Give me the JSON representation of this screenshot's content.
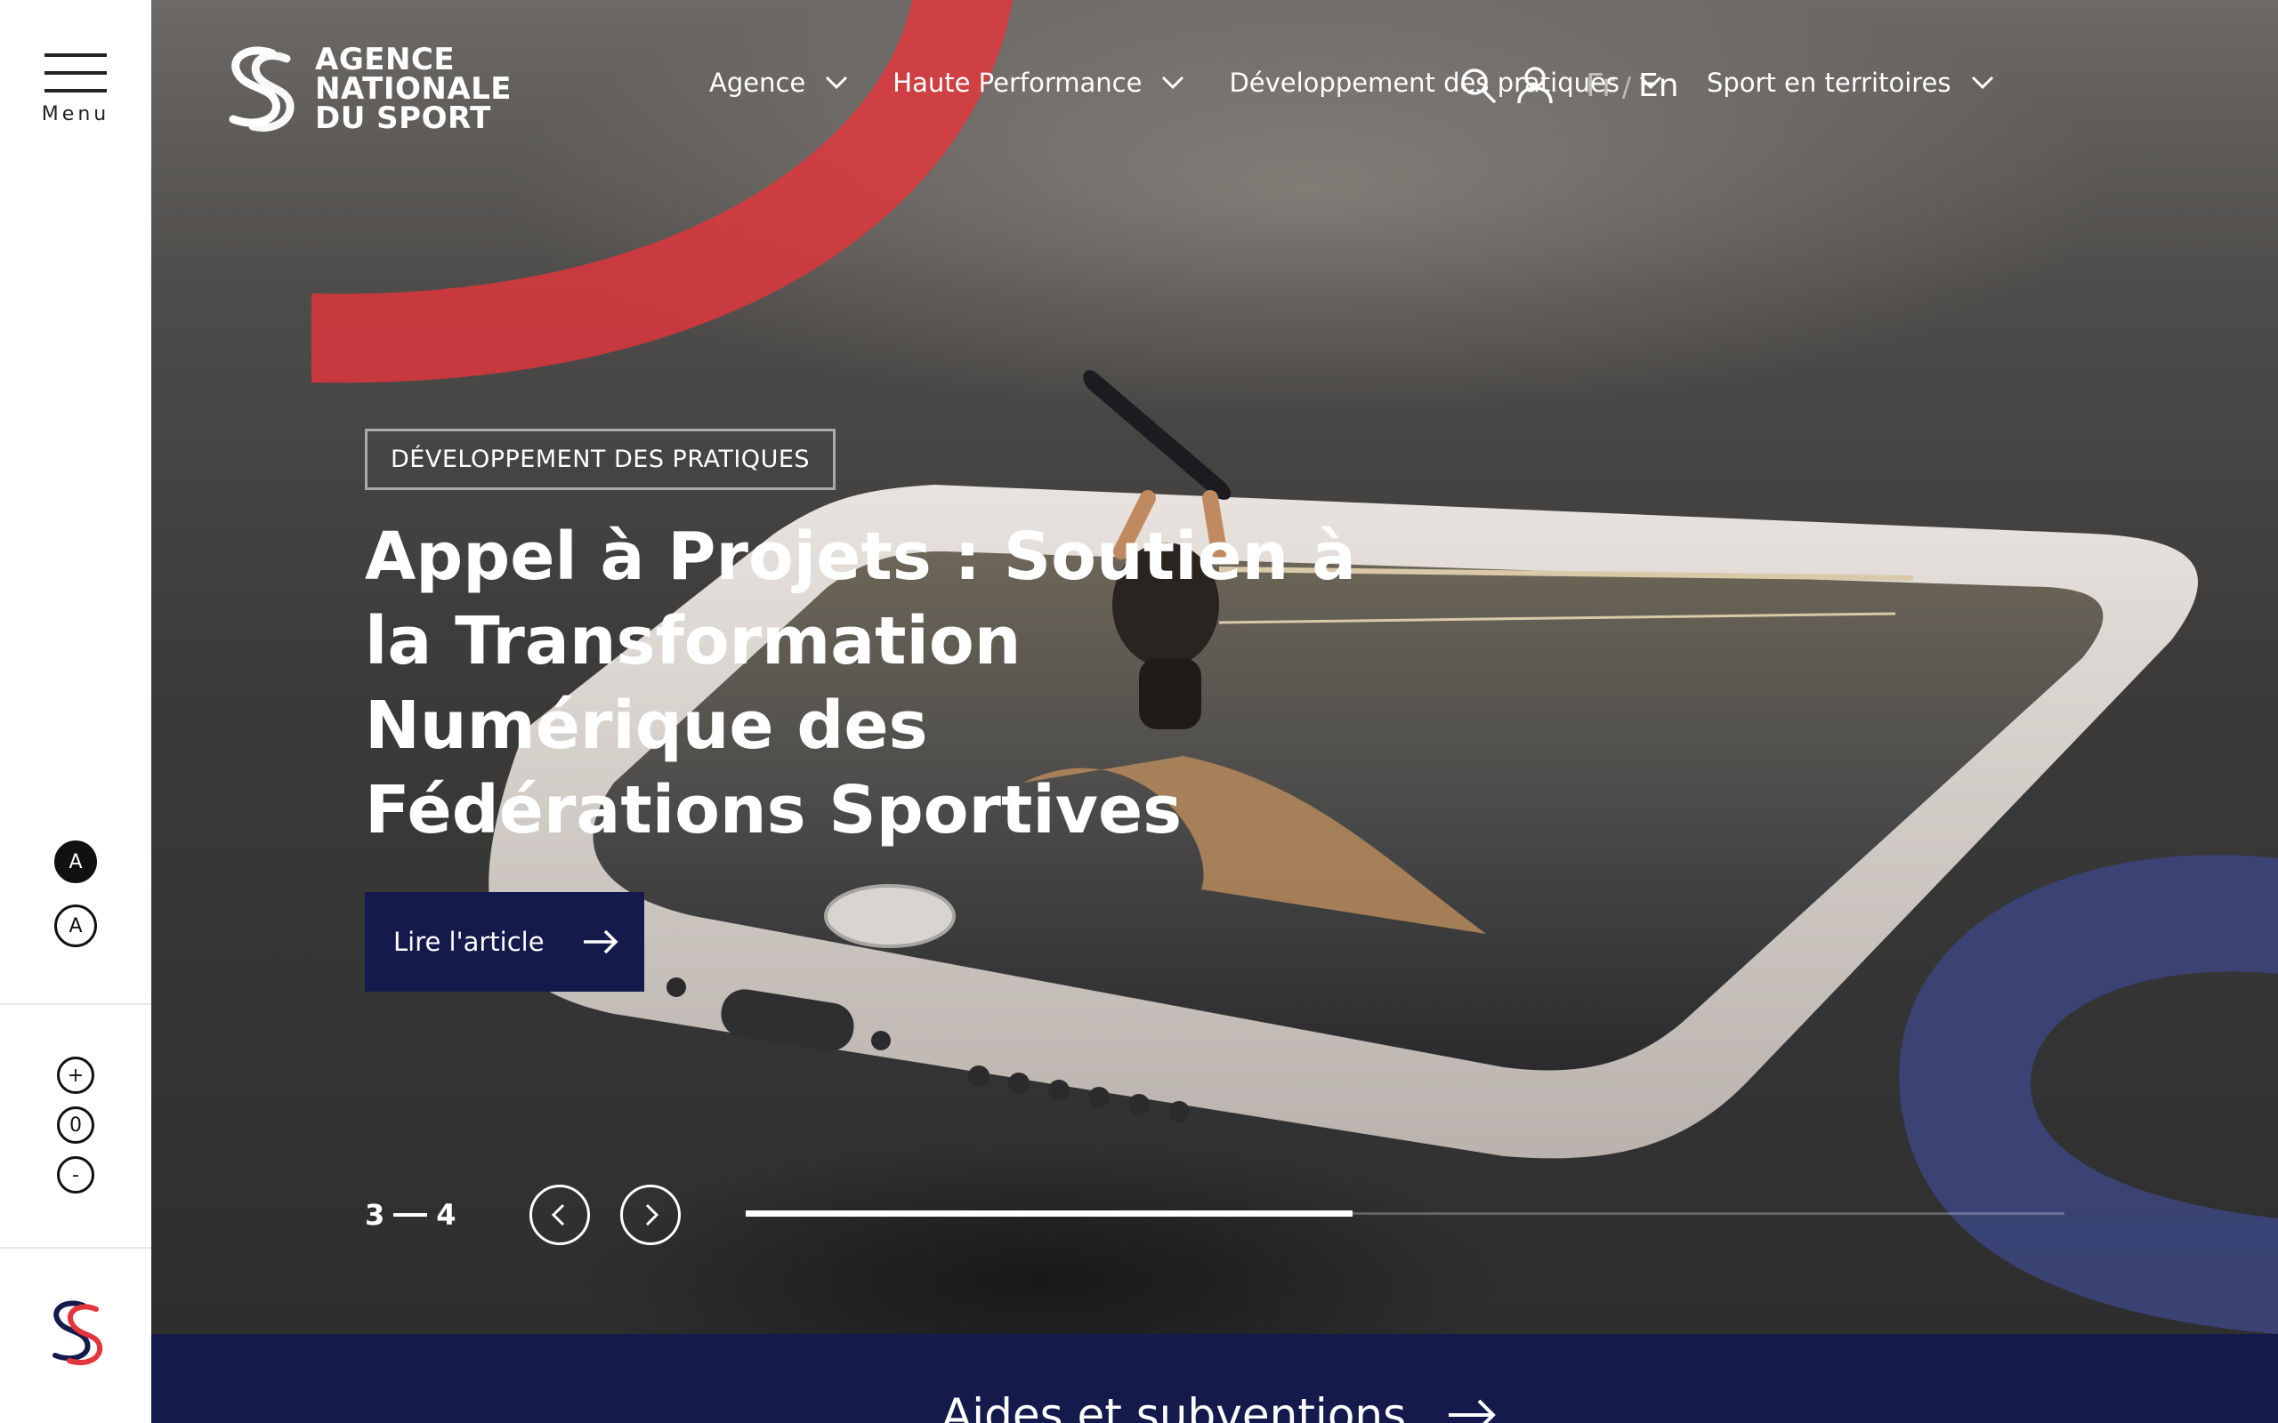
{
  "rail": {
    "menu_label": "Menu",
    "contrast_dark_label": "A",
    "contrast_light_label": "A",
    "zoom_in_label": "+",
    "zoom_reset_label": "0",
    "zoom_out_label": "-"
  },
  "header": {
    "logo_lines": [
      "AGENCE",
      "NATIONALE",
      "DU SPORT"
    ],
    "nav": [
      {
        "label": "Agence"
      },
      {
        "label": "Haute Performance"
      },
      {
        "label": "Développement des pratiques"
      },
      {
        "label": "Sport en territoires"
      }
    ],
    "lang_fr": "Fr",
    "lang_sep": "/",
    "lang_en": "En"
  },
  "slide": {
    "tag": "DÉVELOPPEMENT DES PRATIQUES",
    "title": "Appel à Projets : Soutien à la Transformation Numérique des Fédérations Sportives",
    "cta_label": "Lire l'article"
  },
  "slider": {
    "current": "3",
    "total": "4",
    "progress": 0.46
  },
  "band": {
    "link_label": "Aides et subventions"
  },
  "colors": {
    "brand_navy": "#141a4c",
    "brand_red": "#e3363c",
    "deco_blue": "#3b4479"
  }
}
